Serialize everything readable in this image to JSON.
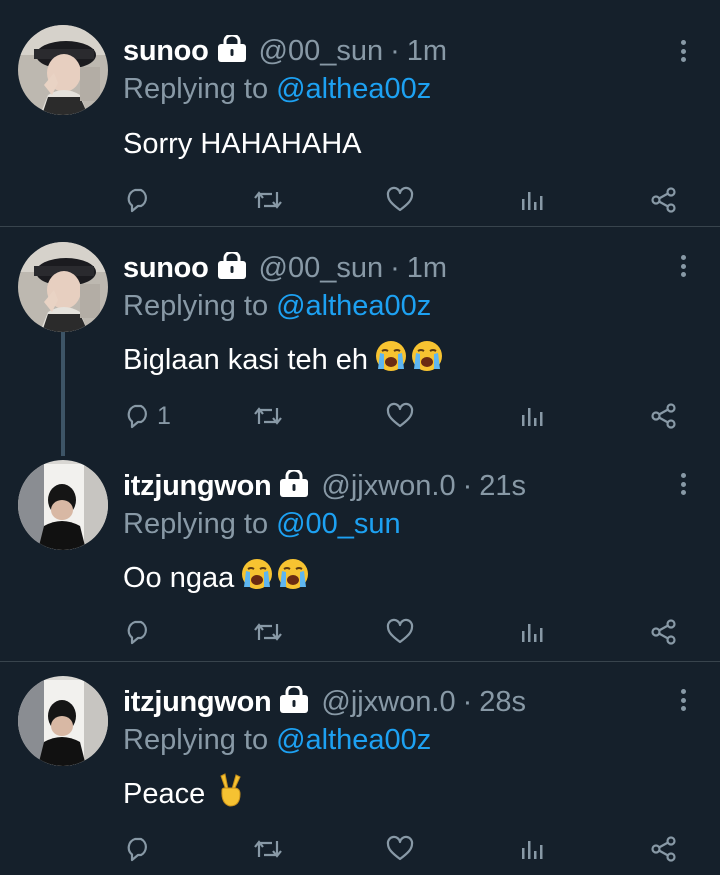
{
  "colors": {
    "background": "#15202b",
    "divider": "#38444d",
    "secondary_text": "#8899a6",
    "link": "#1da1f2",
    "thread_line": "#3d5466"
  },
  "icons": {
    "lock": "lock-icon",
    "more": "more-vertical-icon",
    "reply": "reply-icon",
    "retweet": "retweet-icon",
    "like": "heart-icon",
    "analytics": "analytics-icon",
    "share": "share-icon",
    "crying": "loudly-crying-face-emoji",
    "victory": "victory-hand-emoji"
  },
  "tweets": [
    {
      "name": "sunoo",
      "handle": "@00_sun",
      "separator": "·",
      "time": "1m",
      "reply_prefix": "Replying to",
      "reply_to": "@althea00z",
      "text": "Sorry HAHAHAHA",
      "reply_count": ""
    },
    {
      "name": "sunoo",
      "handle": "@00_sun",
      "separator": "·",
      "time": "1m",
      "reply_prefix": "Replying to",
      "reply_to": "@althea00z",
      "text": "Biglaan kasi teh eh",
      "reply_count": "1"
    },
    {
      "name": "itzjungwon",
      "handle": "@jjxwon.0",
      "separator": "·",
      "time": "21s",
      "reply_prefix": "Replying to",
      "reply_to": "@00_sun",
      "text": "Oo ngaa",
      "reply_count": ""
    },
    {
      "name": "itzjungwon",
      "handle": "@jjxwon.0",
      "separator": "·",
      "time": "28s",
      "reply_prefix": "Replying to",
      "reply_to": "@althea00z",
      "text": "Peace",
      "reply_count": ""
    }
  ]
}
